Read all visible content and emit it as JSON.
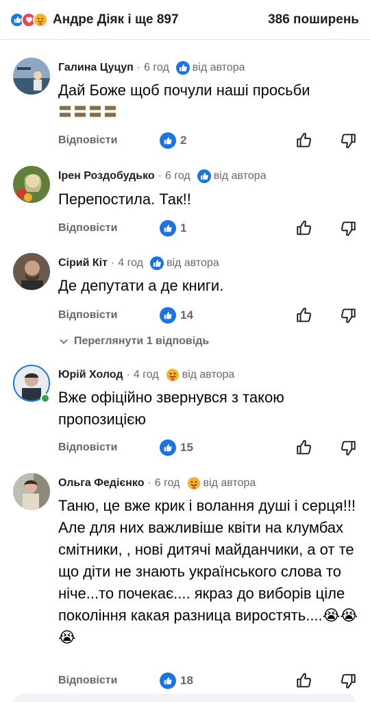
{
  "header": {
    "reactions_text": "Андре Діяк і ще 897",
    "shares_text": "386 поширень",
    "reaction_icons": [
      "like-icon",
      "love-icon",
      "care-icon"
    ]
  },
  "common": {
    "reply_label": "Відповісти",
    "author_badge": "від автора",
    "separator": "·"
  },
  "comments": [
    {
      "author": "Галина Цуцуп",
      "time": "6 год",
      "badge_icon": "like-icon",
      "text": "Дай Боже щоб почули наші просьби",
      "extra": "〓〓〓〓",
      "likes": "2"
    },
    {
      "author": "Ірен Роздобудько",
      "time": "6 год",
      "badge_icon": "like-icon",
      "text": "Перепостила. Так!!",
      "likes": "1"
    },
    {
      "author": "Сірий Кіт",
      "time": "4 год",
      "badge_icon": "like-icon",
      "text": "Де депутати а де книги.",
      "likes": "14",
      "view_replies": "Переглянути 1 відповідь"
    },
    {
      "author": "Юрій Холод",
      "time": "4 год",
      "badge_icon": "care-icon",
      "text": "Вже офіційно звернувся з такою пропозицією",
      "likes": "15"
    },
    {
      "author": "Ольга Федієнко",
      "time": "6 год",
      "badge_icon": "care-icon",
      "text": "Таню, це вже крик і волання душі і серця!!! Але для них важливіше квіти на клумбах смітники, , нові дитячі майданчики, а от те що діти не знають українського слова то ніче...то почекає.... якраз до виборів ціле покоління какая разница виростять....😭😭😭",
      "likes": "18"
    }
  ],
  "colors": {
    "accent": "#1b74e4",
    "love": "#f33e58",
    "care": "#f7b125",
    "muted": "#65676b",
    "online": "#31a24c"
  }
}
